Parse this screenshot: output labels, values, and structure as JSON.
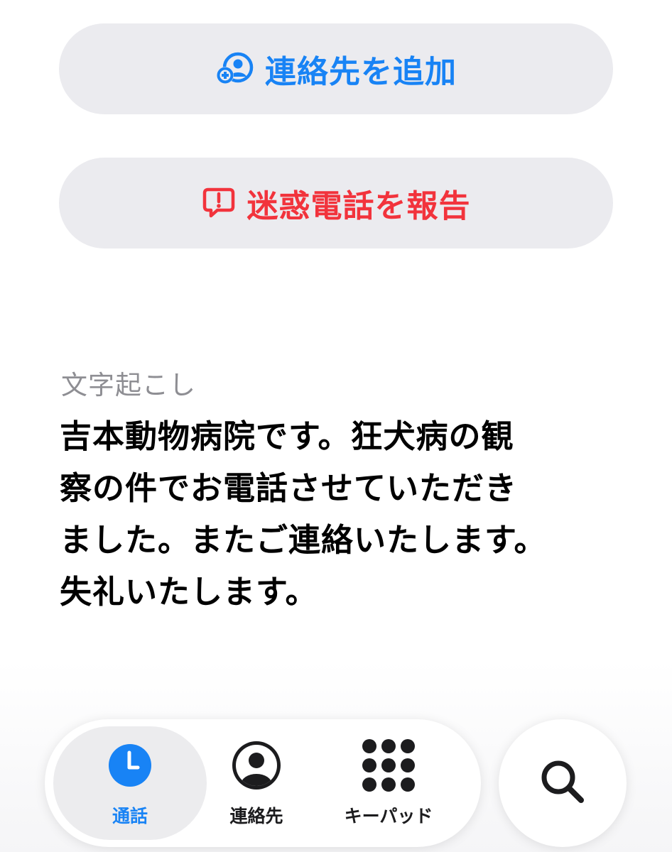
{
  "actions": {
    "add_contact": {
      "label": "連絡先を追加",
      "icon": "person-add-icon",
      "color": "#1883f5"
    },
    "report_spam": {
      "label": "迷惑電話を報告",
      "icon": "report-bubble-icon",
      "color": "#f2333c"
    }
  },
  "transcript": {
    "label": "文字起こし",
    "text": "吉本動物病院です。狂犬病の観\n察の件でお電話させていただき\nました。またご連絡いたします。\n失礼いたします。"
  },
  "tab_bar": {
    "tabs": [
      {
        "label": "通話",
        "icon": "clock-icon",
        "selected": true
      },
      {
        "label": "連絡先",
        "icon": "person-circle-icon",
        "selected": false
      },
      {
        "label": "キーパッド",
        "icon": "keypad-icon",
        "selected": false
      }
    ],
    "search_icon": "search-icon",
    "accent_color": "#1883f5"
  }
}
